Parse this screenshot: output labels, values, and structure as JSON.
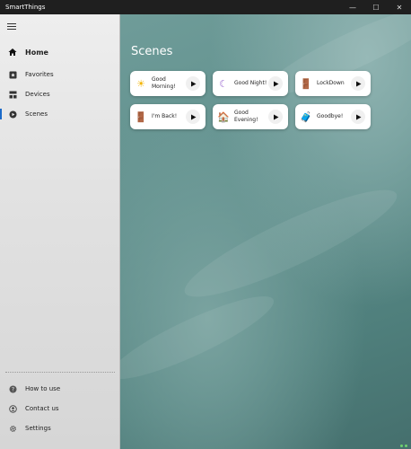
{
  "app": {
    "title": "SmartThings"
  },
  "window_controls": {
    "minimize": "—",
    "maximize": "☐",
    "close": "✕"
  },
  "sidebar": {
    "primary": [
      {
        "label": "Home",
        "icon": "home-icon"
      },
      {
        "label": "Favorites",
        "icon": "favorites-icon"
      },
      {
        "label": "Devices",
        "icon": "devices-icon"
      },
      {
        "label": "Scenes",
        "icon": "scenes-icon"
      }
    ],
    "secondary": [
      {
        "label": "How to use",
        "icon": "help-icon"
      },
      {
        "label": "Contact us",
        "icon": "contact-icon"
      },
      {
        "label": "Settings",
        "icon": "gear-icon"
      }
    ],
    "selected": "Scenes"
  },
  "main": {
    "title": "Scenes",
    "scenes": [
      {
        "label": "Good Morning!",
        "icon": "sun-icon",
        "glyph": "☀"
      },
      {
        "label": "Good Night!",
        "icon": "moon-icon",
        "glyph": "☾"
      },
      {
        "label": "LockDown",
        "icon": "door-icon",
        "glyph": "🚪"
      },
      {
        "label": "I'm Back!",
        "icon": "door-icon",
        "glyph": "🚪"
      },
      {
        "label": "Good Evening!",
        "icon": "house-icon",
        "glyph": "🏠"
      },
      {
        "label": "Goodbye!",
        "icon": "luggage-icon",
        "glyph": "🧳"
      }
    ]
  },
  "colors": {
    "accent": "#1b6ac9",
    "moon": "#9b6ad1",
    "sun": "#f3b400",
    "luggage": "#2f8ee8"
  }
}
